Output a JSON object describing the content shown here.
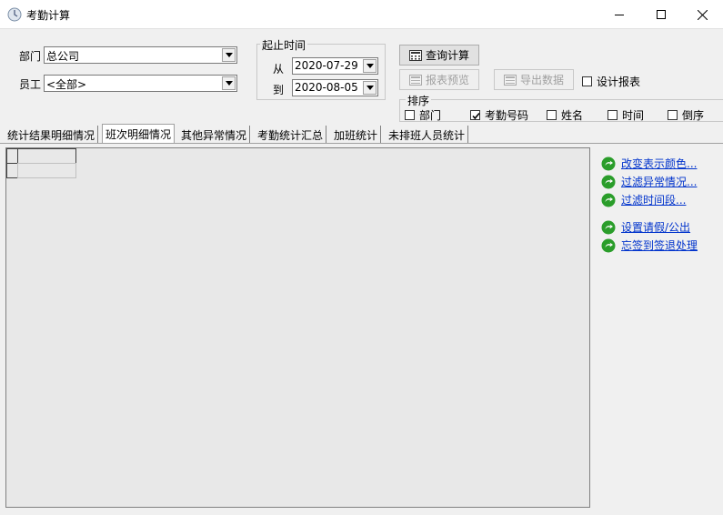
{
  "window": {
    "title": "考勤计算"
  },
  "filters": {
    "dept_label": "部门",
    "dept_value": "总公司",
    "employee_label": "员工",
    "employee_value": "<全部>"
  },
  "period": {
    "title": "起止时间",
    "from_label": "从",
    "from_value": "2020-07-29",
    "to_label": "到",
    "to_value": "2020-08-05"
  },
  "actions": {
    "query": "查询计算",
    "report_preview": "报表预览",
    "export": "导出数据",
    "design_report": "设计报表"
  },
  "sort": {
    "title": "排序",
    "options": [
      {
        "label": "部门",
        "checked": false
      },
      {
        "label": "考勤号码",
        "checked": true
      },
      {
        "label": "姓名",
        "checked": false
      },
      {
        "label": "时间",
        "checked": false
      },
      {
        "label": "倒序",
        "checked": false
      }
    ]
  },
  "tabs": [
    "统计结果明细情况",
    "班次明细情况",
    "其他异常情况",
    "考勤统计汇总",
    "加班统计",
    "未排班人员统计"
  ],
  "active_tab": 1,
  "side_links": [
    "改变表示颜色...",
    "过滤异常情况...",
    "过滤时间段...",
    "设置请假/公出",
    "忘签到签退处理"
  ],
  "colors": {
    "link": "#0033cc",
    "icon_green": "#2a9d2a"
  }
}
